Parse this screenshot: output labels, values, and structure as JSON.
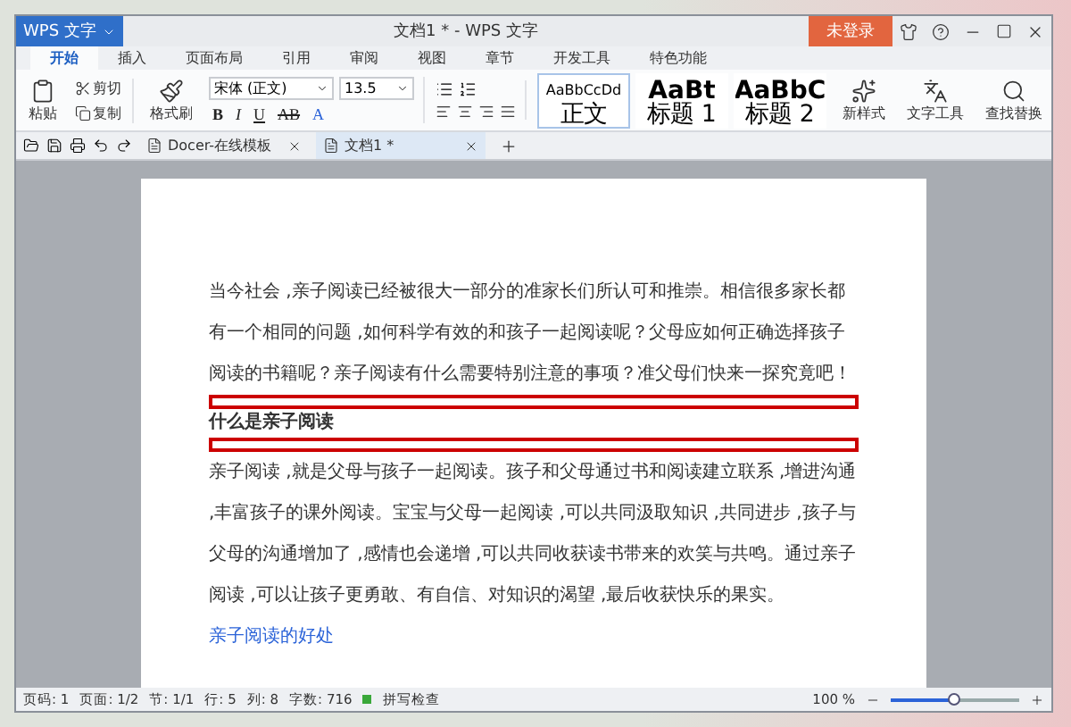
{
  "app_button": "WPS 文字",
  "window": {
    "title": "文档1 * - WPS 文字"
  },
  "login_button": "未登录",
  "ribbon_tabs": [
    {
      "label": "开始",
      "selected": true
    },
    {
      "label": "插入",
      "selected": false
    },
    {
      "label": "页面布局",
      "selected": false
    },
    {
      "label": "引用",
      "selected": false
    },
    {
      "label": "审阅",
      "selected": false
    },
    {
      "label": "视图",
      "selected": false
    },
    {
      "label": "章节",
      "selected": false
    },
    {
      "label": "开发工具",
      "selected": false
    },
    {
      "label": "特色功能",
      "selected": false
    }
  ],
  "clipboard": {
    "paste": "粘贴",
    "cut": "剪切",
    "copy": "复制",
    "format_painter": "格式刷"
  },
  "font": {
    "name": "宋体 (正文)",
    "size": "13.5"
  },
  "format_buttons": [
    {
      "kind": "bold",
      "label": "B"
    },
    {
      "kind": "italic",
      "label": "I"
    },
    {
      "kind": "underline",
      "label": "U"
    },
    {
      "kind": "strike",
      "label": "AB"
    },
    {
      "kind": "color",
      "label": "A"
    }
  ],
  "styles": [
    {
      "preview": "AaBbCcDd",
      "label": "正文",
      "selected": true
    },
    {
      "preview": "AaBt",
      "label": "标题 1",
      "selected": false
    },
    {
      "preview": "AaBbC",
      "label": "标题 2",
      "selected": false
    }
  ],
  "tools": [
    "新样式",
    "文字工具",
    "查找替换"
  ],
  "doc_tabs": [
    {
      "label": "Docer-在线模板",
      "selected": false
    },
    {
      "label": "文档1 *",
      "selected": true
    }
  ],
  "document": [
    {
      "kind": "body",
      "text": "当今社会 ,亲子阅读已经被很大一部分的准家长们所认可和推崇。相信很多家长都有一个相同的问题 ,如何科学有效的和孩子一起阅读呢？父母应如何正确选择孩子阅读的书籍呢？亲子阅读有什么需要特别注意的事项？准父母们快来一探究竟吧！",
      "highlighted": false
    },
    {
      "kind": "heading",
      "text": "什么是亲子阅读",
      "highlighted": true
    },
    {
      "kind": "body",
      "text": "亲子阅读 ,就是父母与孩子一起阅读。孩子和父母通过书和阅读建立联系 ,增进沟通 ,丰富孩子的课外阅读。宝宝与父母一起阅读 ,可以共同汲取知识 ,共同进步 ,孩子与父母的沟通增加了 ,感情也会递增 ,可以共同收获读书带来的欢笑与共鸣。通过亲子阅读 ,可以让孩子更勇敢、有自信、对知识的渴望 ,最后收获快乐的果实。",
      "highlighted": false
    },
    {
      "kind": "link",
      "text": "亲子阅读的好处",
      "highlighted": false
    }
  ],
  "status_bar": {
    "items": [
      "页码: 1",
      "页面: 1/2",
      "节: 1/1",
      "行: 5",
      "列: 8",
      "字数: 716"
    ],
    "spell_check": "拼写检查",
    "zoom": "100 %",
    "zoom_level": {
      "level": 0.5
    }
  }
}
